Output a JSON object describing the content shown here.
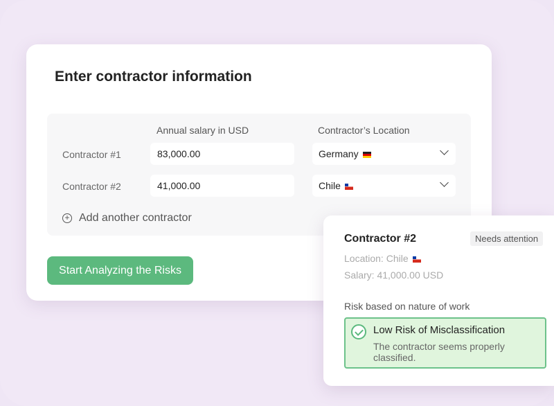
{
  "form": {
    "title": "Enter contractor information",
    "salary_header": "Annual salary in USD",
    "location_header": "Contractor’s Location",
    "rows": [
      {
        "label": "Contractor #1",
        "salary": "83,000.00",
        "location": "Germany"
      },
      {
        "label": "Contractor #2",
        "salary": "41,000.00",
        "location": "Chile"
      }
    ],
    "add_label": "Add another contractor",
    "submit_label": "Start Analyzing the Risks"
  },
  "popup": {
    "title": "Contractor #2",
    "badge": "Needs attention",
    "location": "Location: Chile",
    "salary": "Salary: 41,000.00 USD",
    "risk_label": "Risk based on nature of work",
    "risk_title": "Low Risk of Misclassification",
    "risk_desc": "The contractor seems properly classified."
  },
  "colors": {
    "accent": "#5cb97e",
    "background": "#efe6f5"
  }
}
